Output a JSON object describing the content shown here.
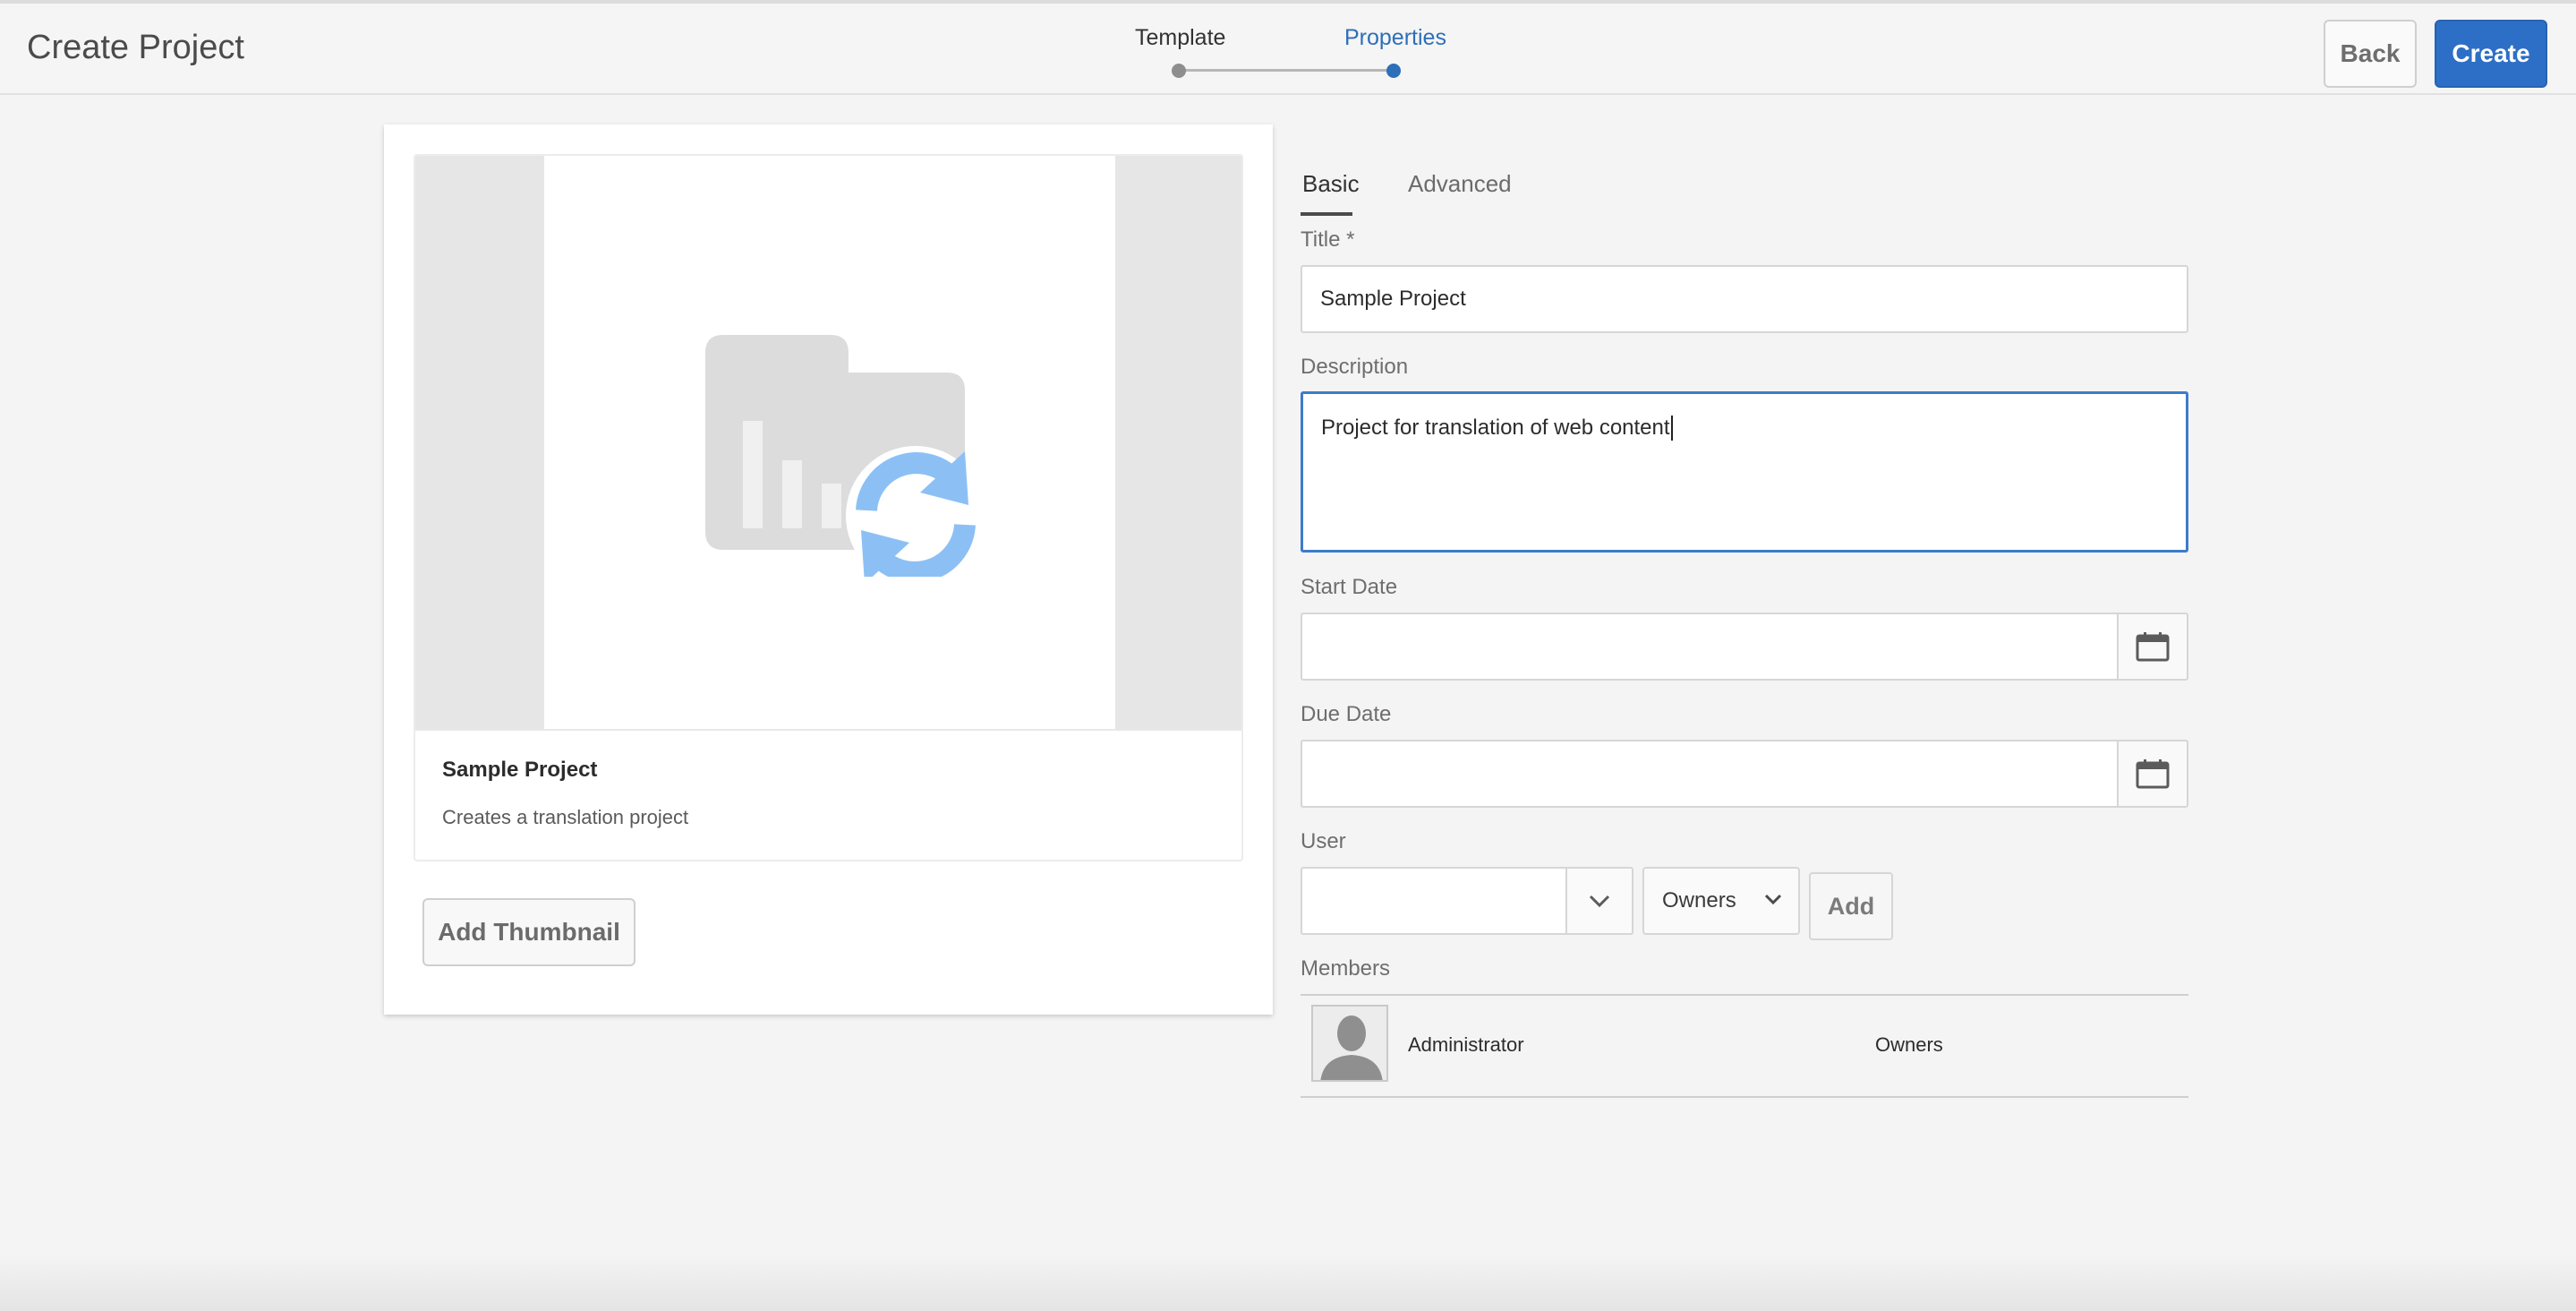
{
  "header": {
    "page_title": "Create Project",
    "steps": [
      {
        "label": "Template",
        "state": "completed"
      },
      {
        "label": "Properties",
        "state": "current"
      }
    ],
    "back_label": "Back",
    "create_label": "Create"
  },
  "card": {
    "title": "Sample Project",
    "description": "Creates a translation project",
    "thumbnail_icon": "translation-project-icon"
  },
  "add_thumbnail_label": "Add Thumbnail",
  "tabs": [
    {
      "label": "Basic",
      "active": true
    },
    {
      "label": "Advanced",
      "active": false
    }
  ],
  "form": {
    "title_label": "Title *",
    "title_value": "Sample Project",
    "description_label": "Description",
    "description_value": "Project for translation of web content",
    "start_date_label": "Start Date",
    "start_date_value": "",
    "due_date_label": "Due Date",
    "due_date_value": "",
    "user_label": "User",
    "user_value": "",
    "role_selected": "Owners",
    "add_label": "Add",
    "members_label": "Members"
  },
  "members": [
    {
      "name": "Administrator",
      "role": "Owners"
    }
  ],
  "colors": {
    "accent": "#2d6fc6",
    "focus_border": "#3d7cc9",
    "step_active": "#2d6fb8"
  }
}
